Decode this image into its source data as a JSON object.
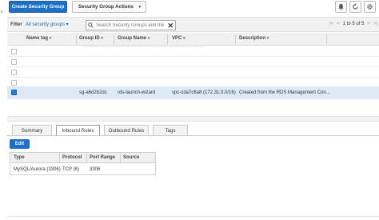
{
  "edge_mark": "s",
  "toolbar": {
    "create_label": "Create Security Group",
    "actions_label": "Security Group Actions",
    "actions_caret": "▾"
  },
  "filter": {
    "label": "Filter",
    "select_value": "All security groups ▾",
    "search_placeholder": "Search Security Groups and their proper",
    "clear_glyph": "✕",
    "pager_first": "|<",
    "pager_prev": "<",
    "pager_info": "1 to 5 of 5",
    "pager_next": ">",
    "pager_last": ">|"
  },
  "table": {
    "columns": [
      "Name tag",
      "Group ID",
      "Group Name",
      "VPC",
      "Description"
    ],
    "sort_arrow": "▾",
    "rows": [
      {
        "name": "",
        "id": "",
        "group": "",
        "vpc": "",
        "desc": "",
        "faded": "— — — — — — — — — — — — — — — — — — — —"
      },
      {
        "name": "",
        "id": "",
        "group": "",
        "vpc": "",
        "desc": ""
      },
      {
        "name": "",
        "id": "",
        "group": "",
        "vpc": "",
        "desc": ""
      },
      {
        "name": "",
        "id": "",
        "group": "",
        "vpc": "",
        "desc": ""
      }
    ],
    "selected": {
      "name": "",
      "id": "sg-a6d2b2dc",
      "group": "rds-launch-wizard",
      "vpc": "vpc-cda7c6a8 (172.31.0.0/16)",
      "desc": "Created from the RDS Management Con..."
    }
  },
  "tabs": [
    "Summary",
    "Inbound Rules",
    "Outbound Rules",
    "Tags"
  ],
  "active_tab": "Inbound Rules",
  "edit_label": "Edit",
  "rules": {
    "headers": [
      "Type",
      "Protocol",
      "Port Range",
      "Source"
    ],
    "row": {
      "type": "MySQL/Aurora (3306)",
      "protocol": "TCP (6)",
      "port": "3306",
      "source": ""
    }
  },
  "colors": {
    "accent": "#1f6fc5",
    "selected_row": "#dceaf8"
  }
}
